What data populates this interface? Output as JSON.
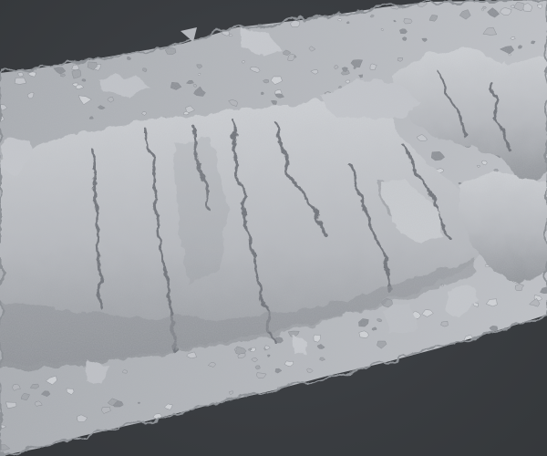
{
  "scene": {
    "description_visible_text": "",
    "background_color": "#3a3d41",
    "mesh_color": "#b9bcc1",
    "mesh_shadow_color": "#7d8187",
    "mesh_highlight_color": "#dcdfe3",
    "crevice_color": "#5d6166",
    "render_style": "clay-matcap",
    "subject": "photogrammetry-rock-outcrop-scan"
  }
}
